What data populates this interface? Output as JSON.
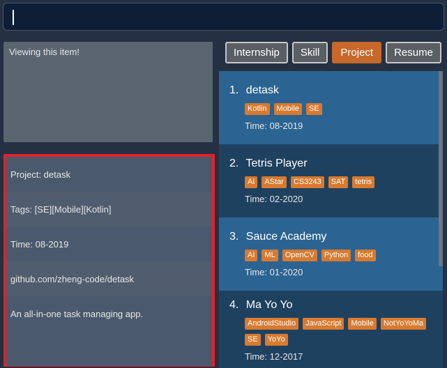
{
  "command_box": {
    "value": "",
    "placeholder": ""
  },
  "result_display": {
    "text": "Viewing this item!"
  },
  "detail": {
    "project": "Project: detask",
    "tags": "Tags: [SE][Mobile][Kotlin]",
    "time": "Time: 08-2019",
    "link": "github.com/zheng-code/detask",
    "description": "An all-in-one task managing app."
  },
  "tabs": [
    {
      "label": "Internship",
      "active": false
    },
    {
      "label": "Skill",
      "active": false
    },
    {
      "label": "Project",
      "active": true
    },
    {
      "label": "Resume",
      "active": false
    }
  ],
  "items": [
    {
      "index": "1.",
      "name": "detask",
      "tags": [
        "Kotlin",
        "Mobile",
        "SE"
      ],
      "time": "Time: 08-2019"
    },
    {
      "index": "2.",
      "name": "Tetris Player",
      "tags": [
        "AI",
        "AStar",
        "CS3243",
        "SAT",
        "tetris"
      ],
      "time": "Time: 02-2020"
    },
    {
      "index": "3.",
      "name": "Sauce Academy",
      "tags": [
        "AI",
        "ML",
        "OpenCV",
        "Python",
        "food"
      ],
      "time": "Time: 01-2020"
    },
    {
      "index": "4.",
      "name": "Ma Yo Yo",
      "tags": [
        "AndroidStudio",
        "JavaScript",
        "Mobile",
        "NotYoYoMa",
        "SE",
        "YoYo"
      ],
      "time": "Time: 12-2017"
    }
  ],
  "colors": {
    "accent": "#c8682b",
    "tag": "#d87a2f",
    "highlight_border": "#e32029",
    "card_light": "#2b6492",
    "card_dark": "#1f4160"
  }
}
